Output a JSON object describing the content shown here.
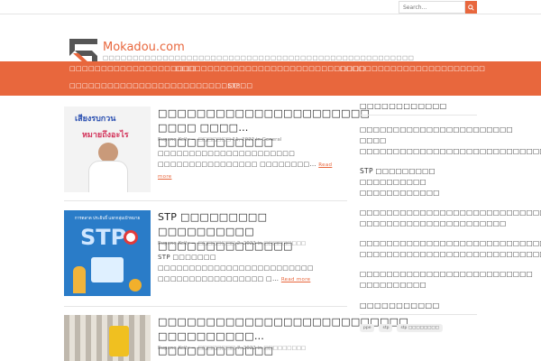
{
  "search": {
    "placeholder": "Search..."
  },
  "site": {
    "title": "Mokadou.com",
    "tagline": "□□□□□□□□□□□□□□□□□□□□□□□□□□□□□□□□□□□□□□□□□□□□□□□□□□□□"
  },
  "nav": {
    "items": [
      {
        "label": "□□□□□□□□□□□□□□□□□□□□"
      },
      {
        "label": "□□□□□□□□□□□□□□□□□□□□□□□□□□□□□□"
      },
      {
        "label": "□□□□□□□□□□□□□□□□□□□□□□□"
      },
      {
        "label": "□□□□□□□□□□□□□□□□□□□□□□□□□□□□□"
      },
      {
        "label": "STP"
      }
    ]
  },
  "articles": [
    {
      "title": "□□□□□□□□□□□□□□□□□□□□□□ □□□□ □□□□… □□□□□□□□□□□□",
      "author": "Eugene Kelly",
      "date": "□□□□□□□ 11, 2022",
      "category": "General",
      "excerpt": "□□□□□□□□□□□□□□□□□□□□□□ □□□□□□□□□□□□□□□□ □□□□□□□□…",
      "thumb_text": [
        "เสียงรบกวน",
        "หมายถึงอะไร"
      ]
    },
    {
      "title": "STP □□□□□□□□□ □□□□□□□□□□ □□□□□□□□□□□□□□",
      "author": "Eugene Kelly",
      "date": "□□□□□□□□ 2, 2022",
      "category": "□□□□□□□□□",
      "excerpt": "STP □□□□□□□ □□□□□□□□□□□□□□□□□□□□□□□□□ □□□□□□□□□□□□□□□□□ □…",
      "thumb_text": [
        "การตลาด ประยิบธิ์ แยกกลุ่มเป้าหมาย",
        "STP"
      ]
    },
    {
      "title": "□□□□□□□□□□□□□□□□□□□□□□□□□□ □□□□□□□□□□… □□□□□□□□□□□□",
      "author": "Eugene Kelly",
      "date": "□□□□□□□□ 7, 2022",
      "category": "□□□□□□□□□"
    }
  ],
  "common": {
    "read_more": "Read more",
    "by_sep": "—",
    "in": "in"
  },
  "sidebar": {
    "widget1_title": "□□□□□□□□□□□□",
    "links": [
      "□□□□□□□□□□□□□□□□□□□□□□□ □□□□ □□□□□□□□□□□□□□□□□□□□□□□□□□□□□",
      "STP □□□□□□□□□ □□□□□□□□□□ □□□□□□□□□□□□",
      "□□□□□□□□□□□□□□□□□□□□□□□□□□□□□ □□□□□□□□□□□□□□□□□□□□□□",
      "□□□□□□□□□□□□□□□□□□□□□□□□□□□□ □□□□□□□□□□□□□□□□□□□□□□□□□□□□□□□",
      "□□□□□□□□□□□□□□□□□□□□□□□□□□ □□□□□□□□□□"
    ],
    "widget2_title": "□□□□□□□□□□□",
    "tags": [
      "ppe",
      "stp",
      "stp □□□□□□□□"
    ]
  },
  "colors": {
    "accent": "#e8673d",
    "thumb2_bg": "#2a7cc8"
  }
}
